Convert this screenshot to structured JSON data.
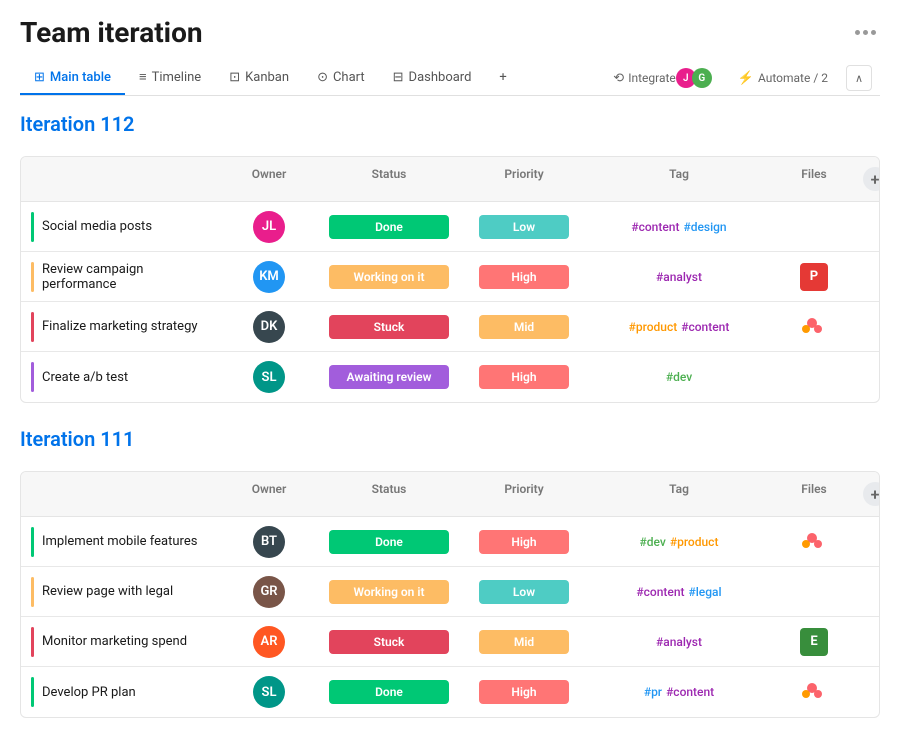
{
  "header": {
    "title": "Team iteration",
    "dots_label": "more options"
  },
  "tabs": [
    {
      "id": "main-table",
      "label": "Main table",
      "icon": "⊞",
      "active": true
    },
    {
      "id": "timeline",
      "label": "Timeline",
      "icon": "≡",
      "active": false
    },
    {
      "id": "kanban",
      "label": "Kanban",
      "icon": "⊡",
      "active": false
    },
    {
      "id": "chart",
      "label": "Chart",
      "icon": "⊙",
      "active": false
    },
    {
      "id": "dashboard",
      "label": "Dashboard",
      "icon": "⊟",
      "active": false
    },
    {
      "id": "add",
      "label": "+",
      "icon": "",
      "active": false
    }
  ],
  "actions": {
    "integrate_label": "Integrate",
    "automate_label": "Automate / 2"
  },
  "columns": {
    "name": "",
    "owner": "Owner",
    "status": "Status",
    "priority": "Priority",
    "tag": "Tag",
    "files": "Files"
  },
  "iterations": [
    {
      "title": "Iteration 112",
      "rows": [
        {
          "id": "row-1",
          "accent_color": "#00c875",
          "name": "Social media posts",
          "owner_initials": "JL",
          "owner_color": "av-pink",
          "status": "Done",
          "status_class": "status-done",
          "priority": "Low",
          "priority_class": "priority-low",
          "tags": [
            {
              "text": "#content",
              "color": "purple"
            },
            {
              "text": "#design",
              "color": "blue"
            }
          ],
          "file_icon": "▣",
          "file_bg": "file-purple",
          "file_letter": ""
        },
        {
          "id": "row-2",
          "accent_color": "#fdbc64",
          "name": "Review campaign performance",
          "owner_initials": "KM",
          "owner_color": "av-blue",
          "status": "Working on it",
          "status_class": "status-working",
          "priority": "High",
          "priority_class": "priority-high",
          "tags": [
            {
              "text": "#analyst",
              "color": "purple"
            }
          ],
          "file_icon": "P",
          "file_bg": "file-red",
          "file_letter": "P"
        },
        {
          "id": "row-3",
          "accent_color": "#e2445c",
          "name": "Finalize marketing strategy",
          "owner_initials": "DK",
          "owner_color": "av-dark",
          "status": "Stuck",
          "status_class": "status-stuck",
          "priority": "Mid",
          "priority_class": "priority-mid",
          "tags": [
            {
              "text": "#product",
              "color": "orange"
            },
            {
              "text": "#content",
              "color": "purple"
            }
          ],
          "file_icon": "asana",
          "file_bg": "file-multi",
          "file_letter": ""
        },
        {
          "id": "row-4",
          "accent_color": "#a25ddc",
          "name": "Create a/b test",
          "owner_initials": "SL",
          "owner_color": "av-teal",
          "status": "Awaiting review",
          "status_class": "status-awaiting",
          "priority": "High",
          "priority_class": "priority-high",
          "tags": [
            {
              "text": "#dev",
              "color": "green"
            }
          ],
          "file_icon": "",
          "file_bg": "",
          "file_letter": ""
        }
      ]
    },
    {
      "title": "Iteration 111",
      "rows": [
        {
          "id": "row-5",
          "accent_color": "#00c875",
          "name": "Implement mobile features",
          "owner_initials": "BT",
          "owner_color": "av-dark",
          "status": "Done",
          "status_class": "status-done",
          "priority": "High",
          "priority_class": "priority-high",
          "tags": [
            {
              "text": "#dev",
              "color": "green"
            },
            {
              "text": "#product",
              "color": "orange"
            }
          ],
          "file_icon": "asana",
          "file_bg": "file-multi",
          "file_letter": ""
        },
        {
          "id": "row-6",
          "accent_color": "#fdbc64",
          "name": "Review page with legal",
          "owner_initials": "GR",
          "owner_color": "av-brown",
          "status": "Working on it",
          "status_class": "status-working",
          "priority": "Low",
          "priority_class": "priority-low",
          "tags": [
            {
              "text": "#content",
              "color": "purple"
            },
            {
              "text": "#legal",
              "color": "blue"
            }
          ],
          "file_icon": "",
          "file_bg": "",
          "file_letter": ""
        },
        {
          "id": "row-7",
          "accent_color": "#e2445c",
          "name": "Monitor marketing spend",
          "owner_initials": "AR",
          "owner_color": "av-orange",
          "status": "Stuck",
          "status_class": "status-stuck",
          "priority": "Mid",
          "priority_class": "priority-mid",
          "tags": [
            {
              "text": "#analyst",
              "color": "purple"
            }
          ],
          "file_icon": "E",
          "file_bg": "file-green",
          "file_letter": "E"
        },
        {
          "id": "row-8",
          "accent_color": "#00c875",
          "name": "Develop PR plan",
          "owner_initials": "SL",
          "owner_color": "av-teal",
          "status": "Done",
          "status_class": "status-done",
          "priority": "High",
          "priority_class": "priority-high",
          "tags": [
            {
              "text": "#pr",
              "color": "blue"
            },
            {
              "text": "#content",
              "color": "purple"
            }
          ],
          "file_icon": "asana",
          "file_bg": "file-multi",
          "file_letter": ""
        }
      ]
    }
  ]
}
